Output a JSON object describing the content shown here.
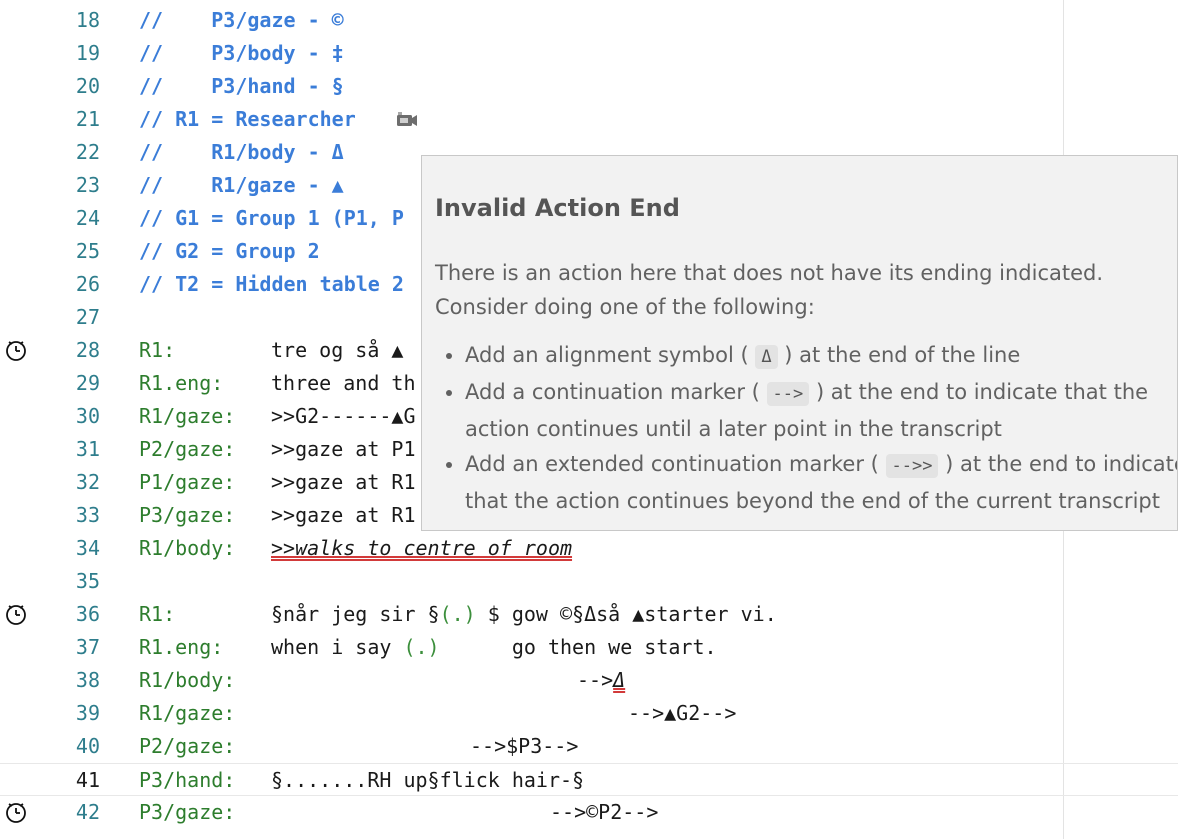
{
  "editor": {
    "lines": [
      {
        "n": "18",
        "comment": "//    P3/gaze - ©"
      },
      {
        "n": "19",
        "comment": "//    P3/body - ‡"
      },
      {
        "n": "20",
        "comment": "//    P3/hand - §"
      },
      {
        "n": "21",
        "comment": "// R1 = Researcher "
      },
      {
        "n": "22",
        "comment": "//    R1/body - Δ"
      },
      {
        "n": "23",
        "comment": "//    R1/gaze - ▲"
      },
      {
        "n": "24",
        "comment": "// G1 = Group 1 (P1, P"
      },
      {
        "n": "25",
        "comment": "// G2 = Group 2"
      },
      {
        "n": "26",
        "comment": "// T2 = Hidden table 2"
      },
      {
        "n": "27"
      },
      {
        "n": "28",
        "label": "R1:",
        "text": "tre og så ▲"
      },
      {
        "n": "29",
        "label": "R1.eng:",
        "text": "three and th"
      },
      {
        "n": "30",
        "label": "R1/gaze:",
        "text": ">>G2------▲G"
      },
      {
        "n": "31",
        "label": "P2/gaze:",
        "text": ">>gaze at P1"
      },
      {
        "n": "32",
        "label": "P1/gaze:",
        "text": ">>gaze at R1"
      },
      {
        "n": "33",
        "label": "P3/gaze:",
        "text": ">>gaze at R1"
      },
      {
        "n": "34",
        "label": "R1/body:",
        "text": ">>walks to centre of room"
      },
      {
        "n": "35"
      },
      {
        "n": "36",
        "label": "R1:",
        "text_a": "§når jeg sir §",
        "text_b": "(.)",
        "text_c": " $ gow ©§Δså ▲starter vi."
      },
      {
        "n": "37",
        "label": "R1.eng:",
        "text_a": "when i say ",
        "text_b": "(.)",
        "text_c": "      go then we start."
      },
      {
        "n": "38",
        "label": "R1/body:",
        "arrow": "-->",
        "mark": "Δ"
      },
      {
        "n": "39",
        "label": "R1/gaze:",
        "text": "-->▲G2-->"
      },
      {
        "n": "40",
        "label": "P2/gaze:",
        "text": "-->$P3-->"
      },
      {
        "n": "41",
        "label": "P3/hand:",
        "text": "§.......RH up§flick hair-§"
      },
      {
        "n": "42",
        "label": "P3/gaze:",
        "text": "-->©P2-->"
      }
    ],
    "researcher_icon": "camera-icon",
    "timer_icon": "clock-icon"
  },
  "hover": {
    "title": "Invalid Action End",
    "description": "There is an action here that does not have its ending indicated. Consider doing one of the following:",
    "items": [
      {
        "pre": "Add an alignment symbol (",
        "code": "Δ",
        "post": ") at the end of the line"
      },
      {
        "pre": "Add a continuation marker (",
        "code": "-->",
        "post": ") at the end to indicate that the action continues until a later point in the transcript"
      },
      {
        "pre": "Add an extended continuation marker (",
        "code": "-->>",
        "post": ") at the end to indicate that the action continues beyond the end of the current transcript"
      }
    ]
  }
}
